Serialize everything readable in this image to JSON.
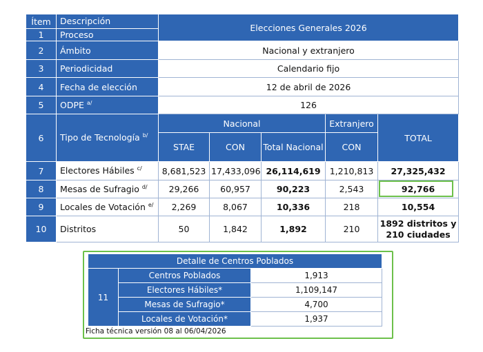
{
  "main_table": {
    "header": {
      "item": "Ítem",
      "descripcion": "Descripción"
    },
    "rows": [
      {
        "num": "1",
        "label": "Proceso",
        "value": "Elecciones Generales 2026"
      },
      {
        "num": "2",
        "label": "Ámbito",
        "value": "Nacional y extranjero"
      },
      {
        "num": "3",
        "label": "Periodicidad",
        "value": "Calendario fijo"
      },
      {
        "num": "4",
        "label": "Fecha de elección",
        "value": "12 de abril de 2026"
      },
      {
        "num": "5",
        "label": "ODPE",
        "note": "a/",
        "value": "126"
      }
    ],
    "tecnologia": {
      "num": "6",
      "label": "Tipo de Tecnología",
      "note": "b/",
      "nacional": "Nacional",
      "extranjero": "Extranjero",
      "total": "TOTAL",
      "stae": "STAE",
      "con": "CON",
      "total_nacional": "Total Nacional",
      "con_ext": "CON"
    },
    "data_rows": [
      {
        "num": "7",
        "label": "Electores Hábiles",
        "note": "c/",
        "stae": "8,681,523",
        "con": "17,433,096",
        "total_nacional": "26,114,619",
        "con_ext": "1,210,813",
        "total": "27,325,432"
      },
      {
        "num": "8",
        "label": "Mesas de Sufragio",
        "note": "d/",
        "stae": "29,266",
        "con": "60,957",
        "total_nacional": "90,223",
        "con_ext": "2,543",
        "total": "92,766"
      },
      {
        "num": "9",
        "label": "Locales de Votación",
        "note": "e/",
        "stae": "2,269",
        "con": "8,067",
        "total_nacional": "10,336",
        "con_ext": "218",
        "total": "10,554"
      },
      {
        "num": "10",
        "label": "Distritos",
        "note": "",
        "stae": "50",
        "con": "1,842",
        "total_nacional": "1,892",
        "con_ext": "210",
        "total_line1": "1892 distritos y",
        "total_line2": "210 ciudades"
      }
    ]
  },
  "detalle": {
    "title": "Detalle de Centros Poblados",
    "num": "11",
    "rows": [
      {
        "label": "Centros Poblados",
        "value": "1,913"
      },
      {
        "label": "Electores Hábiles*",
        "value": "1,109,147"
      },
      {
        "label": "Mesas de Sufragio*",
        "value": "4,700"
      },
      {
        "label": "Locales de Votación*",
        "value": "1,937"
      }
    ]
  },
  "footer": "Ficha técnica versión 08 al 06/04/2026",
  "colors": {
    "header_blue": "#2f66b3",
    "highlight_green": "#6cc04a",
    "border": "#9fb3d3"
  }
}
